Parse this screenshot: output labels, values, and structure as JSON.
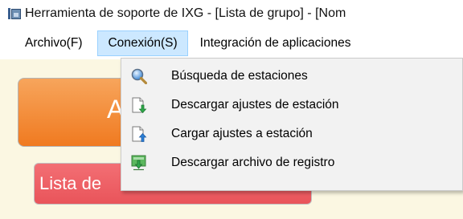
{
  "window": {
    "title": "Herramienta de soporte de IXG - [Lista de grupo] - [Nom"
  },
  "menubar": {
    "items": [
      {
        "label": "Archivo(F)"
      },
      {
        "label": "Conexión(S)"
      },
      {
        "label": "Integración de aplicaciones"
      }
    ]
  },
  "background": {
    "big_button_label": "Ac",
    "small_button_label": "Lista de"
  },
  "dropdown": {
    "items": [
      {
        "label": "Búsqueda de estaciones",
        "icon": "magnifier-icon"
      },
      {
        "label": "Descargar ajustes de estación",
        "icon": "download-document-icon"
      },
      {
        "label": "Cargar ajustes a estación",
        "icon": "upload-document-icon"
      },
      {
        "label": "Descargar archivo de registro",
        "icon": "download-log-icon"
      }
    ]
  }
}
